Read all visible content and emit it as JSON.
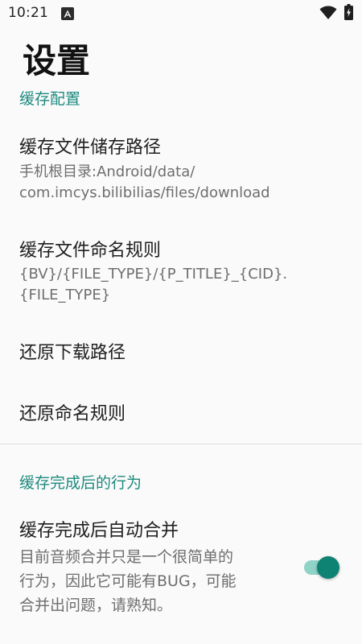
{
  "status_bar": {
    "time": "10:21",
    "icons": [
      "notification-a-icon",
      "wifi-icon",
      "battery-charging-icon"
    ]
  },
  "page": {
    "title": "设置"
  },
  "sections": {
    "cache_config": {
      "header": "缓存配置",
      "items": {
        "cache_path": {
          "title": "缓存文件储存路径",
          "summary": "手机根目录:Android/data/\ncom.imcys.bilibilias/files/download"
        },
        "naming_rule": {
          "title": "缓存文件命名规则",
          "summary": "{BV}/{FILE_TYPE}/{P_TITLE}_{CID}.\n{FILE_TYPE}"
        },
        "restore_path": {
          "title": "还原下载路径"
        },
        "restore_naming": {
          "title": "还原命名规则"
        }
      }
    },
    "after_cache": {
      "header": "缓存完成后的行为",
      "items": {
        "auto_merge": {
          "title": "缓存完成后自动合并",
          "summary": "目前音频合并只是一个很简单的\n行为，因此它可能有BUG，可能\n合并出问题，请熟知。",
          "switch_on": true
        }
      }
    }
  },
  "colors": {
    "accent": "#1d8a7e",
    "switch_thumb": "#0e8373",
    "switch_track": "#8fd3c8",
    "background": "#fafafa"
  }
}
